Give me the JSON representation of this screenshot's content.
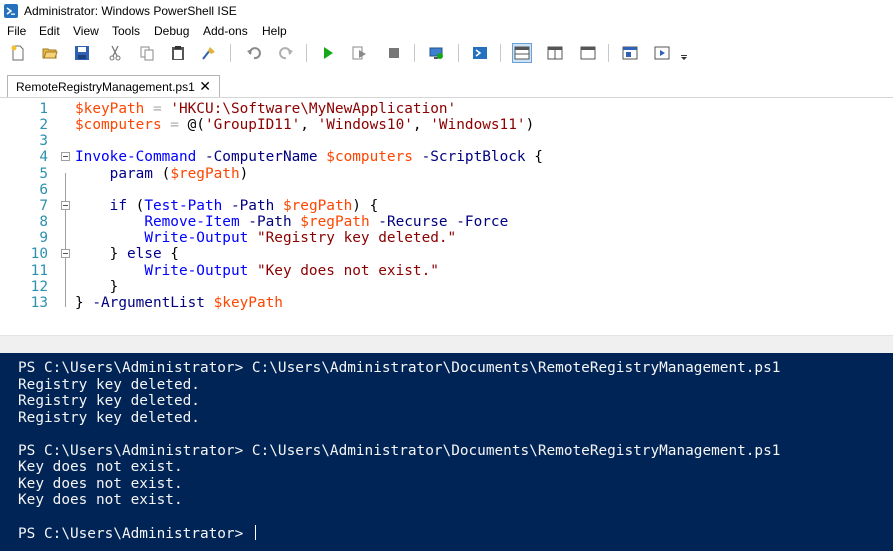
{
  "window": {
    "title": "Administrator: Windows PowerShell ISE",
    "icon": "powershell-ise-icon"
  },
  "menu": [
    "File",
    "Edit",
    "View",
    "Tools",
    "Debug",
    "Add-ons",
    "Help"
  ],
  "toolbar": {
    "buttons": [
      "new-script-icon",
      "open-icon",
      "save-icon",
      "cut-icon",
      "copy-icon",
      "paste-icon",
      "clear-console-icon",
      "undo-icon",
      "redo-icon",
      "run-script-icon",
      "run-selection-icon",
      "stop-icon",
      "new-remote-tab-icon",
      "start-powershell-icon",
      "show-script-pane-top-icon",
      "show-script-pane-right-icon",
      "show-script-pane-maximized-icon",
      "show-commands-addon-icon",
      "show-command-window-icon",
      "toolbar-overflow-icon"
    ]
  },
  "tab": {
    "label": "RemoteRegistryManagement.ps1",
    "close": "✕"
  },
  "editor": {
    "line_numbers": [
      "1",
      "2",
      "3",
      "4",
      "5",
      "6",
      "7",
      "8",
      "9",
      "10",
      "11",
      "12",
      "13"
    ],
    "lines": [
      [
        [
          "var",
          "$keyPath"
        ],
        [
          "op",
          " = "
        ],
        [
          "str",
          "'HKCU:\\Software\\MyNewApplication'"
        ]
      ],
      [
        [
          "var",
          "$computers"
        ],
        [
          "op",
          " = "
        ],
        [
          "pl",
          "@("
        ],
        [
          "str",
          "'GroupID11'"
        ],
        [
          "pl",
          ", "
        ],
        [
          "str",
          "'Windows10'"
        ],
        [
          "pl",
          ", "
        ],
        [
          "str",
          "'Windows11'"
        ],
        [
          "pl",
          ")"
        ]
      ],
      [],
      [
        [
          "cmd",
          "Invoke-Command"
        ],
        [
          "pl",
          " "
        ],
        [
          "par",
          "-ComputerName"
        ],
        [
          "pl",
          " "
        ],
        [
          "var",
          "$computers"
        ],
        [
          "pl",
          " "
        ],
        [
          "par",
          "-ScriptBlock"
        ],
        [
          "pl",
          " {"
        ]
      ],
      [
        [
          "pl",
          "    "
        ],
        [
          "kw",
          "param"
        ],
        [
          "pl",
          " ("
        ],
        [
          "var",
          "$regPath"
        ],
        [
          "pl",
          ")"
        ]
      ],
      [],
      [
        [
          "pl",
          "    "
        ],
        [
          "kw",
          "if"
        ],
        [
          "pl",
          " ("
        ],
        [
          "cmd",
          "Test-Path"
        ],
        [
          "pl",
          " "
        ],
        [
          "par",
          "-Path"
        ],
        [
          "pl",
          " "
        ],
        [
          "var",
          "$regPath"
        ],
        [
          "pl",
          ") {"
        ]
      ],
      [
        [
          "pl",
          "        "
        ],
        [
          "cmd",
          "Remove-Item"
        ],
        [
          "pl",
          " "
        ],
        [
          "par",
          "-Path"
        ],
        [
          "pl",
          " "
        ],
        [
          "var",
          "$regPath"
        ],
        [
          "pl",
          " "
        ],
        [
          "par",
          "-Recurse"
        ],
        [
          "pl",
          " "
        ],
        [
          "par",
          "-Force"
        ]
      ],
      [
        [
          "pl",
          "        "
        ],
        [
          "cmd",
          "Write-Output"
        ],
        [
          "pl",
          " "
        ],
        [
          "str",
          "\"Registry key deleted.\""
        ]
      ],
      [
        [
          "pl",
          "    } "
        ],
        [
          "kw",
          "else"
        ],
        [
          "pl",
          " {"
        ]
      ],
      [
        [
          "pl",
          "        "
        ],
        [
          "cmd",
          "Write-Output"
        ],
        [
          "pl",
          " "
        ],
        [
          "str",
          "\"Key does not exist.\""
        ]
      ],
      [
        [
          "pl",
          "    }"
        ]
      ],
      [
        [
          "pl",
          "} "
        ],
        [
          "par",
          "-ArgumentList"
        ],
        [
          "pl",
          " "
        ],
        [
          "var",
          "$keyPath"
        ]
      ]
    ]
  },
  "console": {
    "lines": [
      "PS C:\\Users\\Administrator> C:\\Users\\Administrator\\Documents\\RemoteRegistryManagement.ps1",
      "Registry key deleted.",
      "Registry key deleted.",
      "Registry key deleted.",
      "",
      "PS C:\\Users\\Administrator> C:\\Users\\Administrator\\Documents\\RemoteRegistryManagement.ps1",
      "Key does not exist.",
      "Key does not exist.",
      "Key does not exist.",
      "",
      "PS C:\\Users\\Administrator> "
    ]
  },
  "colors": {
    "console_bg": "#012456",
    "variable": "#ff4500",
    "string": "#8b0000",
    "command": "#0000ff",
    "parameter": "#000080",
    "keyword": "#00008b",
    "line_number": "#2b91af"
  }
}
